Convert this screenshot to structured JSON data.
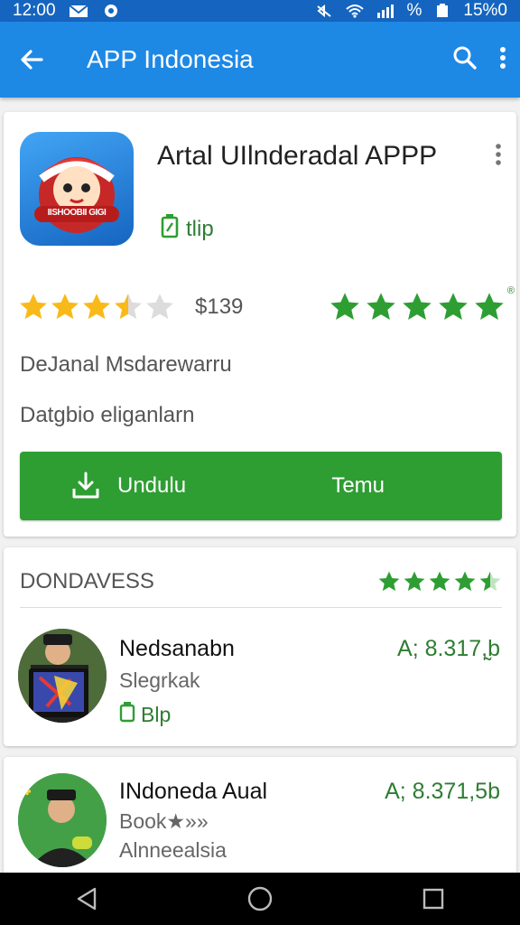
{
  "status_bar": {
    "time": "12:00",
    "battery": "15%0",
    "percent_glyph": "%",
    "icons": [
      "mail-icon",
      "notification-icon",
      "mute-icon",
      "wifi-icon",
      "signal-icon",
      "battery-icon"
    ]
  },
  "app_bar": {
    "title": "APP Indonesia",
    "icons": [
      "back-arrow-icon",
      "search-icon",
      "more-vert-icon"
    ]
  },
  "app": {
    "title": "Artal UIlnderadal APPP",
    "size": "tlip",
    "rating_stars": 3.5,
    "price": "$139",
    "green_stars": 5,
    "developer": "DeJanal Msdarewarru",
    "category": "Datgbio eliganlarn",
    "install_label": "Undulu",
    "open_label": "Temu",
    "icon_text": "IISHOOBII GIGI"
  },
  "section": {
    "title": "DONDAVESS",
    "stars": 4.5
  },
  "items": [
    {
      "name": "Nedsanabn",
      "subtitle": "Slegrkak",
      "size": "Blp",
      "price": "A; 8.317,̰b"
    },
    {
      "name": "INdoneda Aual",
      "subtitle": "Book★»»",
      "subtitle2": "Alnneealsia",
      "price": "A; 8.371,5b"
    }
  ],
  "colors": {
    "primary": "#1e88e5",
    "status": "#1565c0",
    "install": "#2e9e33",
    "green": "#2e9e33",
    "gold": "#f9b919"
  },
  "nav_bar": {
    "icons": [
      "back-triangle-icon",
      "home-circle-icon",
      "recents-square-icon"
    ]
  }
}
